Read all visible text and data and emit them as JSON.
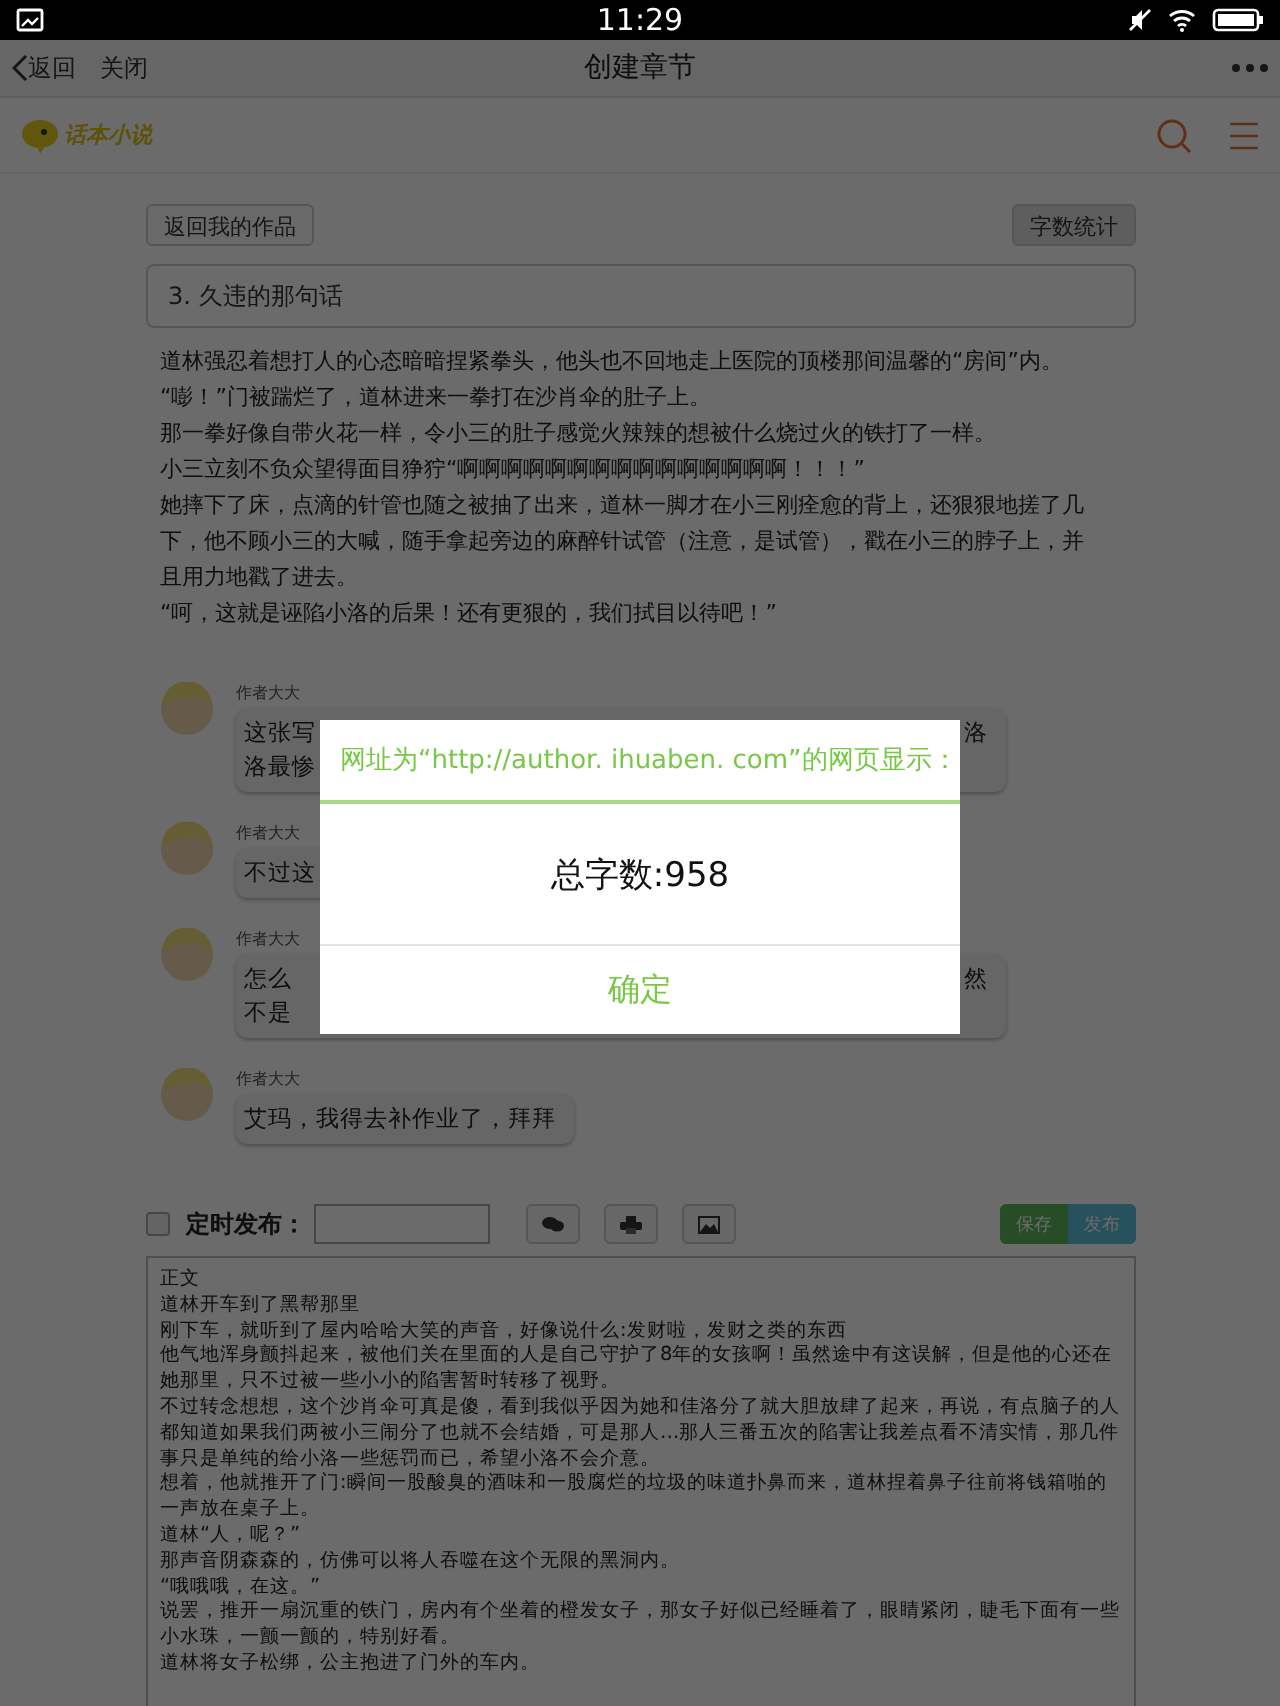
{
  "status_bar": {
    "time": "11:29"
  },
  "nav": {
    "back": "返回",
    "close": "关闭",
    "title": "创建章节"
  },
  "site": {
    "logo": "话本小说"
  },
  "actions": {
    "back_to_works": "返回我的作品",
    "word_count": "字数统计"
  },
  "chapter_title": "3. 久违的那句话",
  "body": [
    "道林强忍着想打人的心态暗暗捏紧拳头，他头也不回地走上医院的顶楼那间温馨的“房间”内。",
    "“嘭！”门被踹烂了，道林进来一拳打在沙肖伞的肚子上。",
    "那一拳好像自带火花一样，令小三的肚子感觉火辣辣的想被什么烧过火的铁打了一样。",
    "小三立刻不负众望得面目狰狞“啊啊啊啊啊啊啊啊啊啊啊啊啊啊啊！！！”",
    "她摔下了床，点滴的针管也随之被抽了出来，道林一脚才在小三刚痊愈的背上，还狠狠地搓了几下，他不顾小三的大喊，随手拿起旁边的麻醉针试管（注意，是试管），戳在小三的脖子上，并且用力地戳了进去。",
    "“呵，这就是诬陷小洛的后果！还有更狠的，我们拭目以待吧！”"
  ],
  "comments": [
    {
      "author": "作者大大",
      "lines": [
        {
          "left": "这张写",
          "right": "洛"
        },
        {
          "left": "洛最惨"
        }
      ]
    },
    {
      "author": "作者大大",
      "lines": [
        {
          "left": "不过这"
        }
      ]
    },
    {
      "author": "作者大大",
      "lines": [
        {
          "left": "怎么",
          "right": "然"
        },
        {
          "left": "不是"
        }
      ]
    },
    {
      "author": "作者大大",
      "lines": [
        {
          "left": "艾玛，我得去补作业了，拜拜"
        }
      ]
    }
  ],
  "toolbar": {
    "schedule_checked": false,
    "schedule_label": "定时发布：",
    "save": "保存",
    "publish": "发布"
  },
  "editor": {
    "lines": [
      "正文",
      "道林开车到了黑帮那里",
      "刚下车，就听到了屋内哈哈大笑的声音，好像说什么:发财啦，发财之类的东西",
      "他气地浑身颤抖起来，被他们关在里面的人是自己守护了8年的女孩啊！虽然途中有这误解，但是他的心还在她那里，只不过被一些小小的陷害暂时转移了视野。",
      "不过转念想想，这个沙肖伞可真是傻，看到我似乎因为她和佳洛分了就大胆放肆了起来，再说，有点脑子的人都知道如果我们两被小三闹分了也就不会结婚，可是那人…那人三番五次的陷害让我差点看不清实情，那几件事只是单纯的给小洛一些惩罚而已，希望小洛不会介意。",
      "想着，他就推开了门:瞬间一股酸臭的酒味和一股腐烂的垃圾的味道扑鼻而来，道林捏着鼻子往前将钱箱啪的一声放在桌子上。",
      "道林“人，呢？”",
      "那声音阴森森的，仿佛可以将人吞噬在这个无限的黑洞内。",
      "“哦哦哦，在这。”",
      "说罢，推开一扇沉重的铁门，房内有个坐着的橙发女子，那女子好似已经睡着了，眼睛紧闭，睫毛下面有一些小水珠，一颤一颤的，特别好看。",
      "道林将女子松绑，公主抱进了门外的车内。"
    ]
  },
  "dialog": {
    "title": "网址为“http://author. ihuaben. com”的网页显示：",
    "message": "总字数:958",
    "ok": "确定"
  }
}
